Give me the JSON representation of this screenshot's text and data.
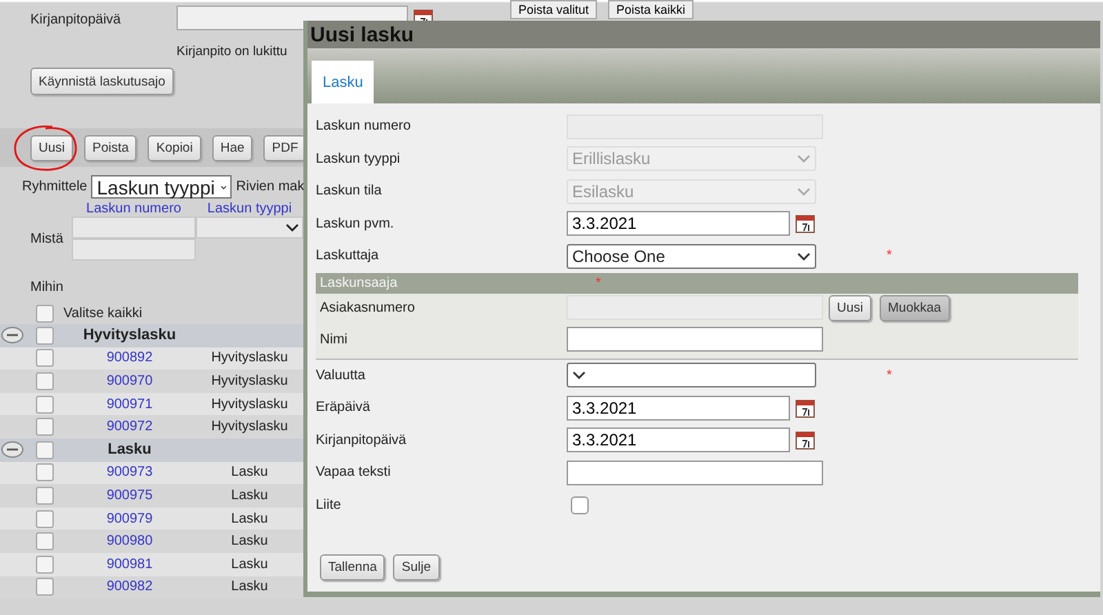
{
  "background": {
    "date_label": "Kirjanpitopäivä",
    "lock_note": "Kirjanpito on lukittu",
    "top_buttons": [
      "Poista valitut",
      "Poista kaikki"
    ],
    "run_button": "Käynnistä laskutusajo",
    "toolbar": [
      {
        "label": "Uusi",
        "circled": true
      },
      {
        "label": "Poista",
        "circled": false
      },
      {
        "label": "Kopioi",
        "circled": false
      },
      {
        "label": "Hae",
        "circled": false
      },
      {
        "label": "PDF",
        "circled": false
      }
    ],
    "group_by": {
      "label": "Ryhmittele",
      "value": "Laskun tyyppi"
    },
    "rows_label": "Rivien mak",
    "columns": [
      "Laskun numero",
      "Laskun tyyppi"
    ],
    "from_label": "Mistä",
    "to_label": "Mihin",
    "select_all": {
      "label": "Valitse kaikki",
      "checked": false
    },
    "groups": [
      {
        "name": "Hyvityslasku",
        "expanded": true,
        "checked": false,
        "rows": [
          {
            "number": "900892",
            "type": "Hyvityslasku",
            "checked": false
          },
          {
            "number": "900970",
            "type": "Hyvityslasku",
            "checked": false
          },
          {
            "number": "900971",
            "type": "Hyvityslasku",
            "checked": false
          },
          {
            "number": "900972",
            "type": "Hyvityslasku",
            "checked": false
          }
        ]
      },
      {
        "name": "Lasku",
        "expanded": true,
        "checked": false,
        "rows": [
          {
            "number": "900973",
            "type": "Lasku",
            "checked": false
          },
          {
            "number": "900975",
            "type": "Lasku",
            "checked": false
          },
          {
            "number": "900979",
            "type": "Lasku",
            "checked": false
          },
          {
            "number": "900980",
            "type": "Lasku",
            "checked": false
          },
          {
            "number": "900981",
            "type": "Lasku",
            "checked": false
          },
          {
            "number": "900982",
            "type": "Lasku",
            "checked": false
          }
        ]
      }
    ]
  },
  "dialog": {
    "title": "Uusi lasku",
    "tabs": [
      {
        "label": "Lasku",
        "selected": true
      }
    ],
    "fields": [
      {
        "label": "Laskun numero",
        "kind": "text",
        "disabled": true,
        "required": false
      },
      {
        "label": "Laskun tyyppi",
        "kind": "select",
        "value": "Erillislasku",
        "disabled": true,
        "required": false
      },
      {
        "label": "Laskun tila",
        "kind": "select",
        "value": "Esilasku",
        "disabled": true,
        "required": false
      },
      {
        "label": "Laskun pvm.",
        "kind": "date",
        "value": "3.3.2021",
        "disabled": false,
        "required": false
      },
      {
        "label": "Laskuttaja",
        "kind": "select",
        "value": "Choose One",
        "disabled": false,
        "required": true
      },
      {
        "label": "Laskunsaaja",
        "kind": "section",
        "required": true,
        "fields": [
          {
            "label": "Asiakasnumero",
            "kind": "text",
            "disabled": true,
            "required": false,
            "buttons": [
              {
                "label": "Uusi",
                "pressed": false
              },
              {
                "label": "Muokkaa",
                "pressed": true
              }
            ]
          },
          {
            "label": "Nimi",
            "kind": "text",
            "disabled": false,
            "required": false
          }
        ]
      },
      {
        "label": "Valuutta",
        "kind": "select",
        "disabled": false,
        "required": true
      },
      {
        "label": "Eräpäivä",
        "kind": "date",
        "value": "3.3.2021",
        "disabled": false,
        "required": false
      },
      {
        "label": "Kirjanpitopäivä",
        "kind": "date",
        "value": "3.3.2021",
        "disabled": false,
        "required": false
      },
      {
        "label": "Vapaa teksti",
        "kind": "text",
        "disabled": false,
        "required": false
      },
      {
        "label": "Liite",
        "kind": "checkbox",
        "checked": false
      }
    ],
    "required_mark": "*",
    "buttons": [
      "Tallenna",
      "Sulje"
    ]
  }
}
